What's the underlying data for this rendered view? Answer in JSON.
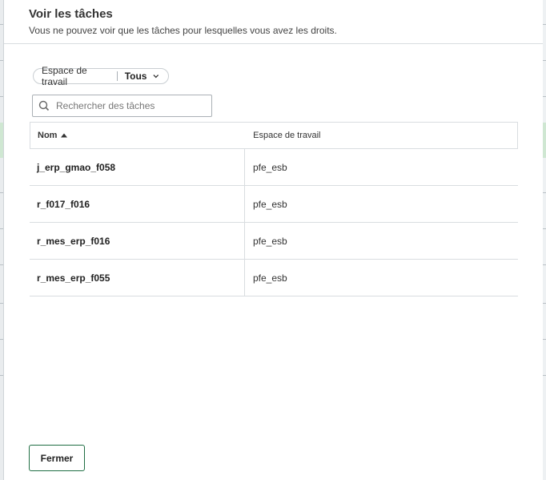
{
  "dialog": {
    "title": "Voir les tâches",
    "subtitle": "Vous ne pouvez voir que les tâches pour lesquelles vous avez les droits."
  },
  "filter": {
    "label": "Espace de travail",
    "value": "Tous",
    "icon": "chevron-down-icon"
  },
  "search": {
    "value": "",
    "placeholder": "Rechercher des tâches",
    "icon": "search-icon"
  },
  "table": {
    "columns": [
      {
        "label": "Nom",
        "sort": "ascending",
        "icon": "sort-up-icon"
      },
      {
        "label": "Espace de travail"
      }
    ],
    "rows": [
      {
        "name": "j_erp_gmao_f058",
        "workspace": "pfe_esb"
      },
      {
        "name": "r_f017_f016",
        "workspace": "pfe_esb"
      },
      {
        "name": "r_mes_erp_f016",
        "workspace": "pfe_esb"
      },
      {
        "name": "r_mes_erp_f055",
        "workspace": "pfe_esb"
      }
    ]
  },
  "footer": {
    "close_label": "Fermer"
  },
  "colors": {
    "border": "#d9dde0",
    "button_border": "#1f6e43",
    "text": "#222222"
  }
}
